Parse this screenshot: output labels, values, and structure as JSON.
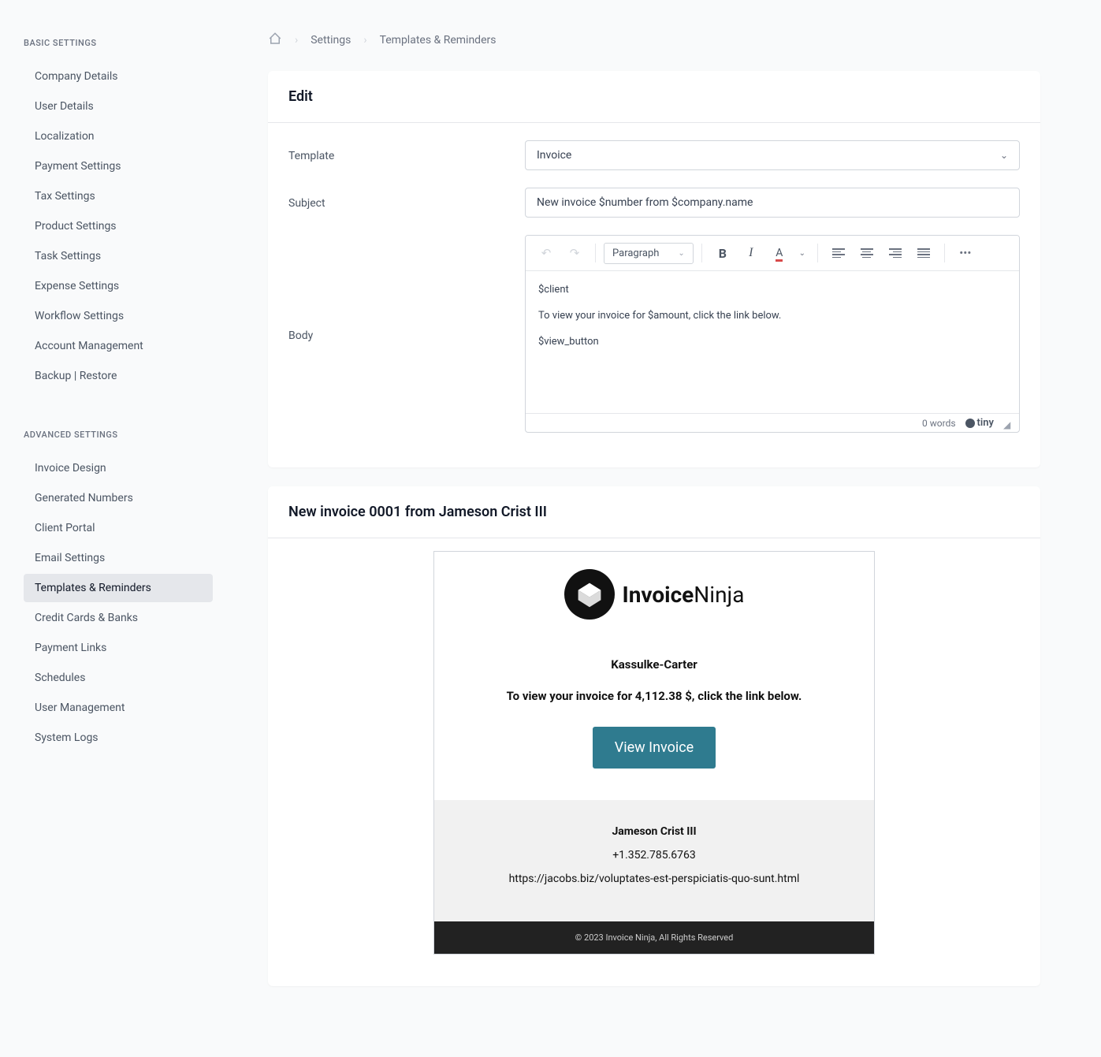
{
  "sidebar": {
    "basic_title": "BASIC SETTINGS",
    "basic_items": [
      "Company Details",
      "User Details",
      "Localization",
      "Payment Settings",
      "Tax Settings",
      "Product Settings",
      "Task Settings",
      "Expense Settings",
      "Workflow Settings",
      "Account Management",
      "Backup | Restore"
    ],
    "advanced_title": "ADVANCED SETTINGS",
    "advanced_items": [
      "Invoice Design",
      "Generated Numbers",
      "Client Portal",
      "Email Settings",
      "Templates & Reminders",
      "Credit Cards & Banks",
      "Payment Links",
      "Schedules",
      "User Management",
      "System Logs"
    ],
    "active": "Templates & Reminders"
  },
  "breadcrumb": {
    "settings": "Settings",
    "current": "Templates & Reminders"
  },
  "edit_card": {
    "title": "Edit",
    "template_label": "Template",
    "template_value": "Invoice",
    "subject_label": "Subject",
    "subject_value": "New invoice $number from $company.name",
    "body_label": "Body",
    "body_line1": "$client",
    "body_line2": "To view your invoice for $amount, click the link below.",
    "body_line3": "$view_button"
  },
  "editor_toolbar": {
    "format": "Paragraph",
    "word_count": "0 words",
    "tiny": "tiny"
  },
  "preview": {
    "header": "New invoice 0001 from Jameson Crist III",
    "logo_main": "Invoice",
    "logo_sub": "Ninja",
    "client": "Kassulke-Carter",
    "message": "To view your invoice for 4,112.38 $, click the link below.",
    "button": "View Invoice",
    "sender": "Jameson Crist III",
    "phone": "+1.352.785.6763",
    "url": "https://jacobs.biz/voluptates-est-perspiciatis-quo-sunt.html",
    "footer": "© 2023 Invoice Ninja, All Rights Reserved"
  }
}
